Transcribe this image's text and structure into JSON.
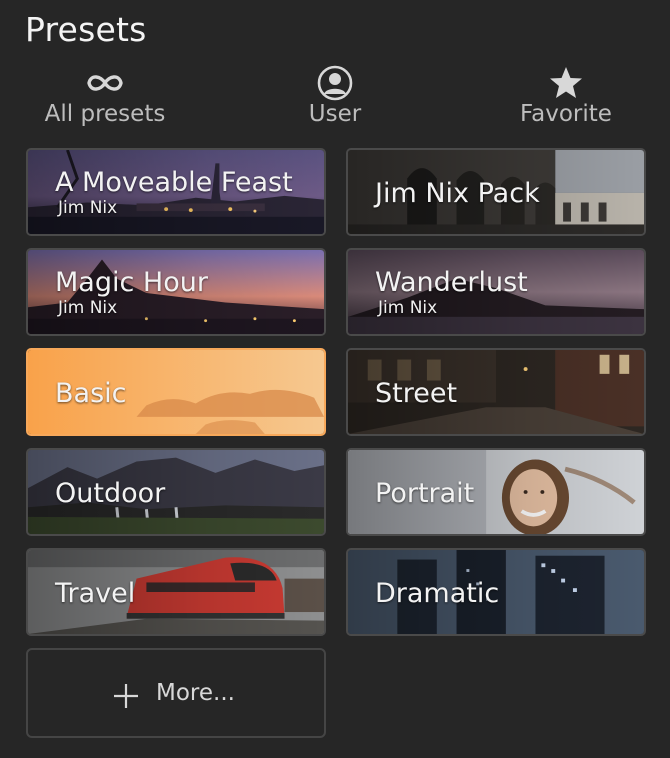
{
  "header": {
    "title": "Presets"
  },
  "filters": [
    {
      "label": "All presets",
      "icon": "infinity-icon"
    },
    {
      "label": "User",
      "icon": "user-icon"
    },
    {
      "label": "Favorite",
      "icon": "star-icon"
    }
  ],
  "presets": [
    {
      "name": "A Moveable Feast",
      "author": "Jim Nix"
    },
    {
      "name": "Jim Nix Pack",
      "author": ""
    },
    {
      "name": "Magic Hour",
      "author": "Jim Nix"
    },
    {
      "name": "Wanderlust",
      "author": "Jim Nix"
    },
    {
      "name": "Basic",
      "author": ""
    },
    {
      "name": "Street",
      "author": ""
    },
    {
      "name": "Outdoor",
      "author": ""
    },
    {
      "name": "Portrait",
      "author": ""
    },
    {
      "name": "Travel",
      "author": ""
    },
    {
      "name": "Dramatic",
      "author": ""
    }
  ],
  "more": {
    "label": "More..."
  },
  "colors": {
    "background": "#262626",
    "accent": "#f7a85a",
    "card_border": "#4a4a4a"
  }
}
